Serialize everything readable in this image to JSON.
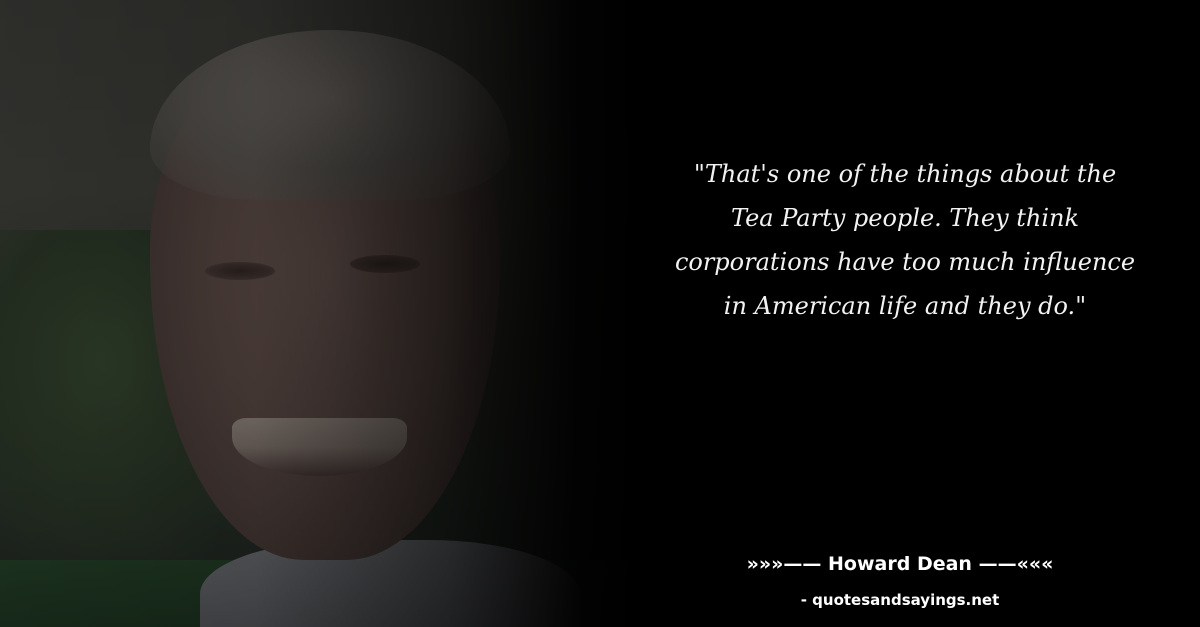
{
  "quote": {
    "text": "\"That's one of the things about the Tea Party people. They think corporations have too much influence in American life and they do.\""
  },
  "author": {
    "line": "»»»—— Howard Dean ——«««"
  },
  "site": {
    "credit": "- quotesandsayings.net"
  },
  "colors": {
    "background": "#000000",
    "text": "#ffffff"
  }
}
